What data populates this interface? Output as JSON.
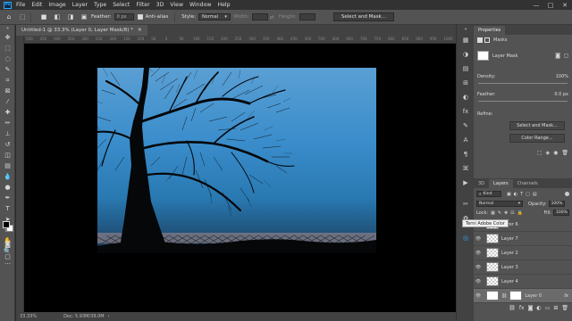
{
  "menubar": {
    "logo": "Ps",
    "items": [
      "File",
      "Edit",
      "Image",
      "Layer",
      "Type",
      "Select",
      "Filter",
      "3D",
      "View",
      "Window",
      "Help"
    ],
    "controls": [
      "—",
      "□",
      "✕"
    ]
  },
  "options": {
    "feather_label": "Feather:",
    "feather_value": "0 px",
    "antialias_label": "Anti-alias",
    "style_label": "Style:",
    "style_value": "Normal",
    "width_label": "Width:",
    "height_label": "Height:",
    "select_mask_button": "Select and Mask..."
  },
  "document": {
    "tab_title": "Untitled-1 @ 33.3% (Layer 0, Layer Mask/8) *",
    "zoom": "33.33%",
    "doc_size": "Doc: 5.93M/39.0M"
  },
  "ruler_ticks": [
    "500",
    "450",
    "400",
    "350",
    "300",
    "250",
    "200",
    "150",
    "100",
    "50",
    "0",
    "50",
    "100",
    "150",
    "200",
    "250",
    "300",
    "350",
    "400",
    "450",
    "500",
    "550",
    "600",
    "650",
    "700",
    "750",
    "800",
    "850",
    "900",
    "950",
    "1000"
  ],
  "properties": {
    "tab": "Properties",
    "masks_label": "Masks",
    "layer_mask_label": "Layer Mask",
    "density_label": "Density:",
    "density_value": "100%",
    "feather_label": "Feather:",
    "feather_value": "0.0 px",
    "refine_label": "Refine:",
    "select_and_mask_button": "Select and Mask...",
    "color_range_button": "Color Range..."
  },
  "layers_panel": {
    "tabs": [
      "3D",
      "Layers",
      "Channels"
    ],
    "active_tab": "Layers",
    "filter_kind": "Kind",
    "blend_mode": "Normal",
    "opacity_label": "Opacity:",
    "opacity_value": "100%",
    "fill_label": "Fill:",
    "fill_value": "100%",
    "lock_label": "Lock:",
    "layers": [
      {
        "name": "Layer 6"
      },
      {
        "name": "Layer 7"
      },
      {
        "name": "Layer 2"
      },
      {
        "name": "Layer 3"
      },
      {
        "name": "Layer 4"
      },
      {
        "name": "Layer 0",
        "selected": true
      }
    ]
  },
  "tooltip": "Terni Adobe Color",
  "colors": {
    "sky_top": "#5a9fd4",
    "sky_mid": "#2979b2",
    "ground": "#050709",
    "accent": "#31a8ff"
  }
}
